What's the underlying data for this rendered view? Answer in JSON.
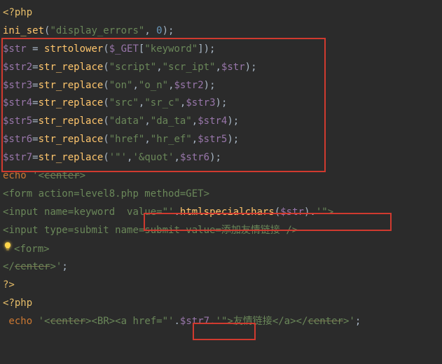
{
  "code": {
    "l1": {
      "open": "<?php"
    },
    "l2": {
      "fn": "ini_set",
      "s1": "\"display_errors\"",
      "comma": ", ",
      "num": "0",
      "close": ");"
    },
    "l3": {
      "v": "$str",
      "eq": " = ",
      "fn": "strtolower",
      "arg": "$_GET",
      "idx": "\"keyword\"",
      "close": "]);"
    },
    "l4": {
      "v": "$str2",
      "fn": "str_replace",
      "a1": "\"script\"",
      "a2": "\"scr_ipt\"",
      "a3": "$str"
    },
    "l5": {
      "v": "$str3",
      "fn": "str_replace",
      "a1": "\"on\"",
      "a2": "\"o_n\"",
      "a3": "$str2"
    },
    "l6": {
      "v": "$str4",
      "fn": "str_replace",
      "a1": "\"src\"",
      "a2": "\"sr_c\"",
      "a3": "$str3"
    },
    "l7": {
      "v": "$str5",
      "fn": "str_replace",
      "a1": "\"data\"",
      "a2": "\"da_ta\"",
      "a3": "$str4"
    },
    "l8": {
      "v": "$str6",
      "fn": "str_replace",
      "a1": "\"href\"",
      "a2": "\"hr_ef\"",
      "a3": "$str5"
    },
    "l9": {
      "v": "$str7",
      "fn": "str_replace",
      "a1": "'\"'",
      "a2": "'&quot'",
      "a3": "$str6"
    },
    "l10": {
      "pre": "echo ",
      "q": "'",
      "open": "<",
      "tag": "center",
      "close": ">"
    },
    "l11": {
      "open": "<",
      "tag": "form",
      "attrs": " action=level8.php method=GET>"
    },
    "l12": {
      "open": "<",
      "tag": "input",
      "a1": " name=keyword  ",
      "a2": "value=\"",
      "q1": "'",
      "dot1": ".",
      "fn": "htmlspecialchars",
      "var": "$str",
      "dot2": ".",
      "q2": "'",
      "a3": "\"",
      "close": ">"
    },
    "l13": {
      "open": "<",
      "tag": "input",
      "attrs": " type=submit name=submit value=",
      "cjk": "添加友情链接",
      "end": " />"
    },
    "l14": {
      "open": "<",
      "slash": "",
      "tag": "form",
      "close": ">"
    },
    "l15": {
      "open": "</",
      "tag": "center",
      "close": ">",
      "q": "'",
      ";": ";"
    },
    "l16": {
      "t": "?>"
    },
    "l17": {
      "t": "<?php"
    },
    "l18": {
      "pre": " echo ",
      "q": "'",
      "t1": "<",
      "center": "center",
      "t2": "><BR><a href=\"",
      "q2": "'",
      "dot1": ".",
      "var": "$str7",
      "dot2": ".",
      "q3": "'",
      "t3": "\">",
      "cjk": "友情链接",
      "t4": "</a></",
      "center2": "center",
      "t5": ">",
      "q4": "'",
      ";": ";"
    }
  }
}
